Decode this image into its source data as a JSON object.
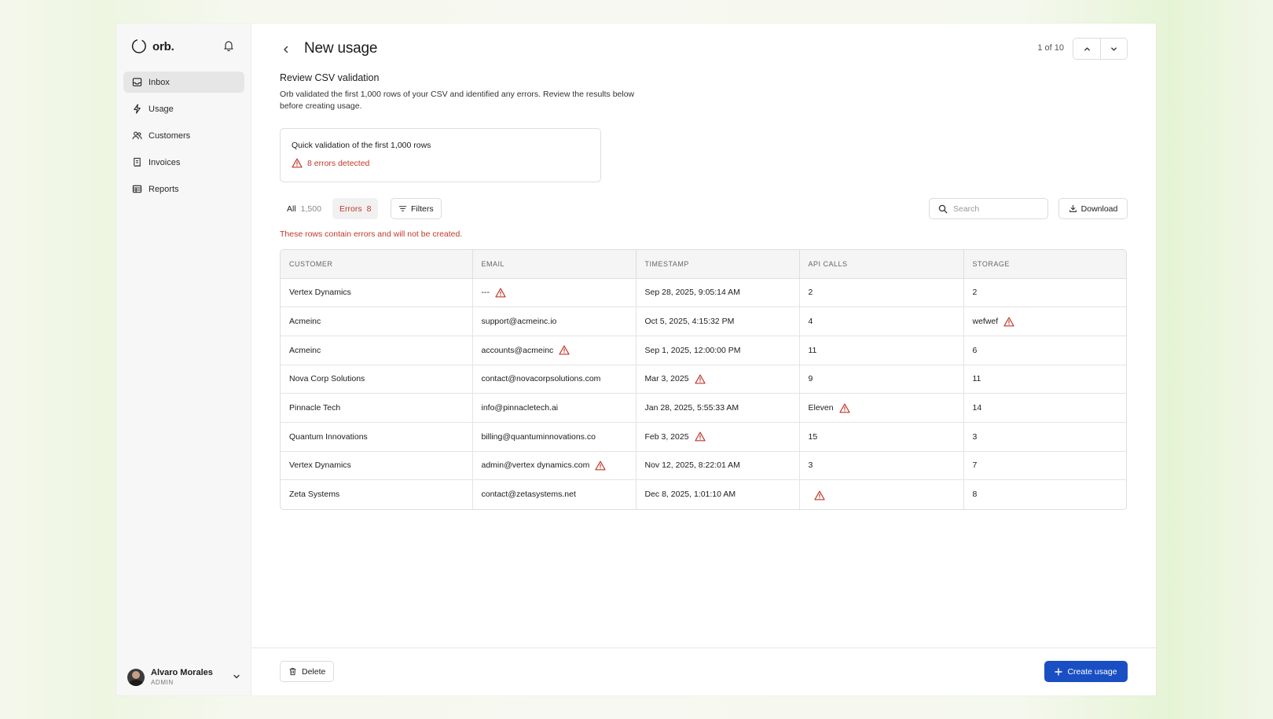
{
  "brand": {
    "name": "orb.",
    "logo_icon": "orb-logo-icon"
  },
  "sidebar": {
    "items": [
      {
        "label": "Inbox",
        "icon": "inbox-icon",
        "active": true
      },
      {
        "label": "Usage",
        "icon": "lightning-icon",
        "active": false
      },
      {
        "label": "Customers",
        "icon": "users-icon",
        "active": false
      },
      {
        "label": "Invoices",
        "icon": "receipt-icon",
        "active": false
      },
      {
        "label": "Reports",
        "icon": "table-icon",
        "active": false
      }
    ],
    "user": {
      "name": "Alvaro Morales",
      "role": "ADMIN"
    }
  },
  "header": {
    "title": "New usage",
    "pager": "1 of 10"
  },
  "review": {
    "title": "Review CSV validation",
    "description": "Orb validated the first 1,000 rows of your CSV and identified any errors. Review the results below before creating usage."
  },
  "validation": {
    "title": "Quick validation of the first 1,000 rows",
    "errors_text": "8 errors detected"
  },
  "toolbar": {
    "all_label": "All",
    "all_count": "1,500",
    "errors_label": "Errors",
    "errors_count": "8",
    "filters_label": "Filters",
    "search_placeholder": "Search",
    "download_label": "Download"
  },
  "errors_note": "These rows contain errors and will not be created.",
  "table": {
    "columns": [
      "CUSTOMER",
      "EMAIL",
      "TIMESTAMP",
      "API CALLS",
      "STORAGE"
    ],
    "rows": [
      [
        {
          "v": "Vertex Dynamics",
          "err": false
        },
        {
          "v": "---",
          "err": true
        },
        {
          "v": "Sep 28, 2025, 9:05:14 AM",
          "err": false
        },
        {
          "v": "2",
          "err": false
        },
        {
          "v": "2",
          "err": false
        }
      ],
      [
        {
          "v": "Acmeinc",
          "err": false
        },
        {
          "v": "support@acmeinc.io",
          "err": false
        },
        {
          "v": "Oct 5, 2025, 4:15:32 PM",
          "err": false
        },
        {
          "v": "4",
          "err": false
        },
        {
          "v": "wefwef",
          "err": true
        }
      ],
      [
        {
          "v": "Acmeinc",
          "err": false
        },
        {
          "v": "accounts@acmeinc",
          "err": true
        },
        {
          "v": "Sep 1, 2025, 12:00:00 PM",
          "err": false
        },
        {
          "v": "11",
          "err": false
        },
        {
          "v": "6",
          "err": false
        }
      ],
      [
        {
          "v": "Nova Corp Solutions",
          "err": false
        },
        {
          "v": "contact@novacorpsolutions.com",
          "err": false
        },
        {
          "v": "Mar 3, 2025",
          "err": true
        },
        {
          "v": "9",
          "err": false
        },
        {
          "v": "11",
          "err": false
        }
      ],
      [
        {
          "v": "Pinnacle Tech",
          "err": false
        },
        {
          "v": "info@pinnacletech.ai",
          "err": false
        },
        {
          "v": "Jan 28, 2025, 5:55:33 AM",
          "err": false
        },
        {
          "v": "Eleven",
          "err": true
        },
        {
          "v": "14",
          "err": false
        }
      ],
      [
        {
          "v": "Quantum Innovations",
          "err": false
        },
        {
          "v": "billing@quantuminnovations.co",
          "err": false
        },
        {
          "v": "Feb 3, 2025",
          "err": true
        },
        {
          "v": "15",
          "err": false
        },
        {
          "v": "3",
          "err": false
        }
      ],
      [
        {
          "v": "Vertex Dynamics",
          "err": false
        },
        {
          "v": "admin@vertex dynamics.com",
          "err": true
        },
        {
          "v": "Nov 12, 2025, 8:22:01 AM",
          "err": false
        },
        {
          "v": "3",
          "err": false
        },
        {
          "v": "7",
          "err": false
        }
      ],
      [
        {
          "v": "Zeta Systems",
          "err": false
        },
        {
          "v": "contact@zetasystems.net",
          "err": false
        },
        {
          "v": "Dec 8, 2025, 1:01:10 AM",
          "err": false
        },
        {
          "v": "",
          "err": true
        },
        {
          "v": "8",
          "err": false
        }
      ]
    ]
  },
  "footer": {
    "delete_label": "Delete",
    "create_label": "Create usage"
  },
  "colors": {
    "accent": "#1a4fc4",
    "error": "#c0392b"
  }
}
